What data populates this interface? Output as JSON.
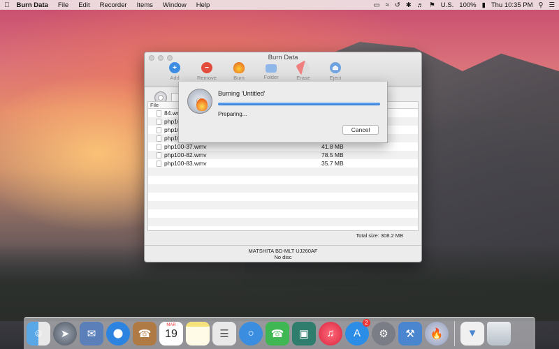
{
  "menubar": {
    "app_name": "Burn Data",
    "menus": [
      "File",
      "Edit",
      "Recorder",
      "Items",
      "Window",
      "Help"
    ],
    "keyboard": "U.S.",
    "battery": "100%",
    "clock": "Thu 10:35 PM"
  },
  "window": {
    "title": "Burn Data",
    "toolbar": [
      {
        "label": "Add",
        "icon": "add-icon"
      },
      {
        "label": "Remove",
        "icon": "remove-icon"
      },
      {
        "label": "Burn",
        "icon": "burn-icon"
      },
      {
        "label": "Folder",
        "icon": "folder-icon"
      },
      {
        "label": "Erase",
        "icon": "erase-icon"
      },
      {
        "label": "Eject",
        "icon": "eject-icon"
      }
    ],
    "column_header": "File",
    "files": [
      {
        "name": "84.wm",
        "size": ""
      },
      {
        "name": "php10",
        "size": ""
      },
      {
        "name": "php10",
        "size": ""
      },
      {
        "name": "php10",
        "size": ""
      },
      {
        "name": "php100-37.wmv",
        "size": "41.8 MB"
      },
      {
        "name": "php100-82.wmv",
        "size": "78.5 MB"
      },
      {
        "name": "php100-83.wmv",
        "size": "35.7 MB"
      }
    ],
    "total": "Total size: 308.2 MB",
    "drive": "MATSHITA BD-MLT UJ260AF",
    "disc_status": "No disc"
  },
  "sheet": {
    "heading": "Burning 'Untitled'",
    "state": "Preparing...",
    "progress": 1.0,
    "cancel_label": "Cancel"
  },
  "dock": {
    "calendar_month": "MAR",
    "calendar_day": "19",
    "app_store_badge": "2",
    "colors": {
      "accent": "#2f7bd8",
      "badge": "#e33333"
    }
  }
}
